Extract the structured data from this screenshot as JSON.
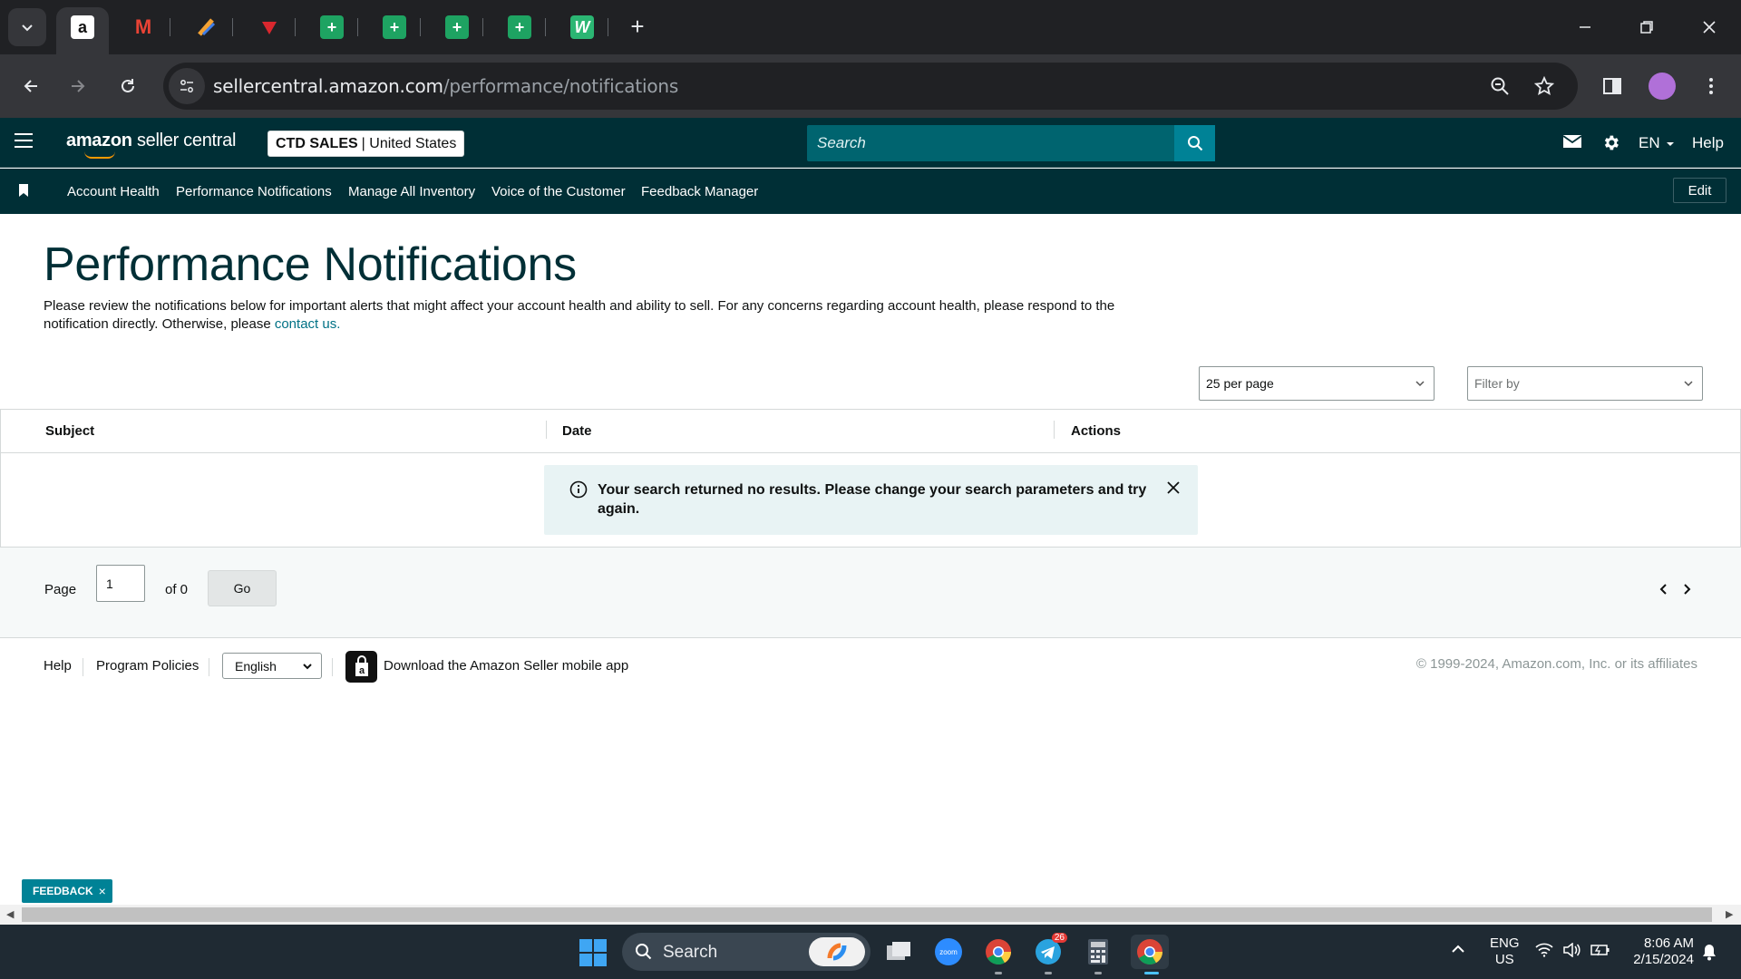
{
  "browser": {
    "url_host": "sellercentral.amazon.com",
    "url_path": "/performance/notifications",
    "tabs": [
      {
        "icon": "amazon-icon",
        "active": true
      },
      {
        "icon": "gmail-icon"
      },
      {
        "icon": "pencil-app-icon"
      },
      {
        "icon": "red-badge-icon"
      },
      {
        "icon": "sheets-icon"
      },
      {
        "icon": "sheets-icon"
      },
      {
        "icon": "sheets-icon"
      },
      {
        "icon": "sheets-icon"
      },
      {
        "icon": "w-app-icon"
      }
    ],
    "new_tab": "+"
  },
  "header": {
    "logo_bold": "amazon",
    "logo_text": "seller central",
    "account_name": "CTD SALES",
    "account_marketplace": "| United States",
    "search_placeholder": "Search",
    "language": "EN",
    "help": "Help"
  },
  "nav": {
    "items": [
      "Account Health",
      "Performance Notifications",
      "Manage All Inventory",
      "Voice of the Customer",
      "Feedback Manager"
    ],
    "edit": "Edit"
  },
  "page": {
    "title": "Performance Notifications",
    "description": "Please review the notifications below for important alerts that might affect your account health and ability to sell. For any concerns regarding account health, please respond to the notification directly. Otherwise, please ",
    "contact_link": "contact us.",
    "per_page": "25 per page",
    "filter_placeholder": "Filter by"
  },
  "table": {
    "columns": [
      "Subject",
      "Date",
      "Actions"
    ],
    "alert": "Your search returned no results. Please change your search parameters and try again."
  },
  "pager": {
    "page_label": "Page",
    "page_value": "1",
    "of_label": "of 0",
    "go": "Go"
  },
  "footer": {
    "help": "Help",
    "policies": "Program Policies",
    "language": "English",
    "app_link": "Download the Amazon Seller mobile app",
    "copyright": "© 1999-2024, Amazon.com, Inc. or its affiliates"
  },
  "feedback": {
    "label": "FEEDBACK",
    "close": "×"
  },
  "taskbar": {
    "search": "Search",
    "lang_top": "ENG",
    "lang_bottom": "US",
    "time": "8:06 AM",
    "date": "2/15/2024",
    "telegram_badge": "26"
  },
  "colors": {
    "header_bg": "#002f36",
    "accent_teal": "#008296",
    "link": "#007185",
    "alert_bg": "#e8f3f4"
  }
}
